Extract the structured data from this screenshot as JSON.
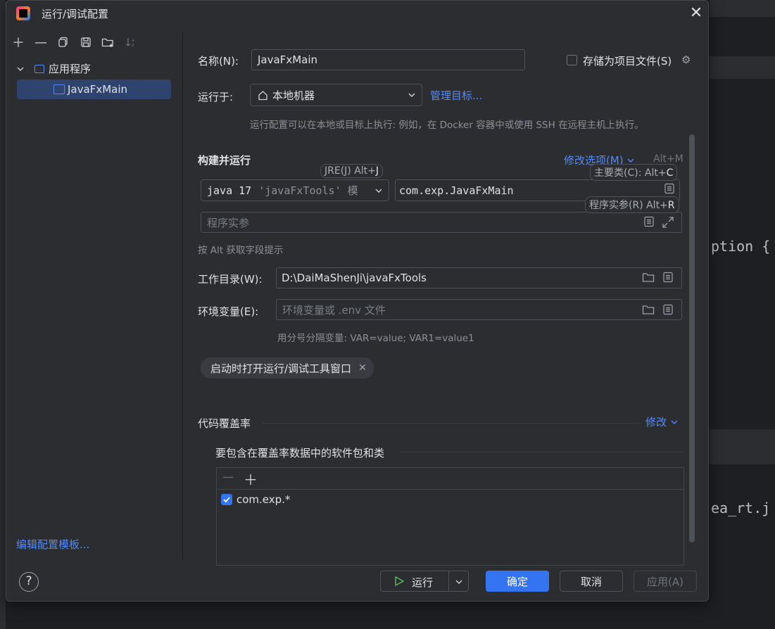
{
  "dialog": {
    "title": "运行/调试配置"
  },
  "left": {
    "tree_root": "应用程序",
    "tree_item": "JavaFxMain",
    "edit_templates": "编辑配置模板..."
  },
  "form": {
    "name_label": "名称(N):",
    "name_value": "JavaFxMain",
    "store_label": "存储为项目文件(S)",
    "run_on_label": "运行于:",
    "run_on_value": "本地机器",
    "manage_targets": "管理目标...",
    "run_on_hint": "运行配置可以在本地或目标上执行: 例如，在 Docker 容器中或使用 SSH 在远程主机上执行。",
    "build_run_title": "构建并运行",
    "modify_options": "修改选项(M)",
    "modify_shortcut": "Alt+M",
    "jre_tooltip_a": "JRE(J) Alt+",
    "jre_tooltip_b": "J",
    "jre_value_a": "java 17",
    "jre_value_b": "'javaFxTools' 模",
    "mainclass_tooltip_a": "主要类(C): Alt+",
    "mainclass_tooltip_b": "C",
    "mainclass_value": "com.exp.JavaFxMain",
    "args_tooltip_a": "程序实参(R) Alt+",
    "args_tooltip_b": "R",
    "args_placeholder": "程序实参",
    "alt_hint": "按 Alt 获取字段提示",
    "workdir_label": "工作目录(W):",
    "workdir_value": "D:\\DaiMaShenJi\\javaFxTools",
    "env_label": "环境变量(E):",
    "env_placeholder": "环境变量或 .env 文件",
    "env_hint": "用分号分隔变量: VAR=value; VAR1=value1",
    "chip_label": "启动时打开运行/调试工具窗口",
    "coverage_title": "代码覆盖率",
    "coverage_modify": "修改",
    "coverage_subtitle": "要包含在覆盖率数据中的软件包和类",
    "coverage_item": "com.exp.*"
  },
  "footer": {
    "help": "?",
    "run": "运行",
    "ok": "确定",
    "cancel": "取消",
    "apply": "应用(A)"
  },
  "background": {
    "code_line1": "ption {",
    "code_line2": "ea_rt.j"
  }
}
